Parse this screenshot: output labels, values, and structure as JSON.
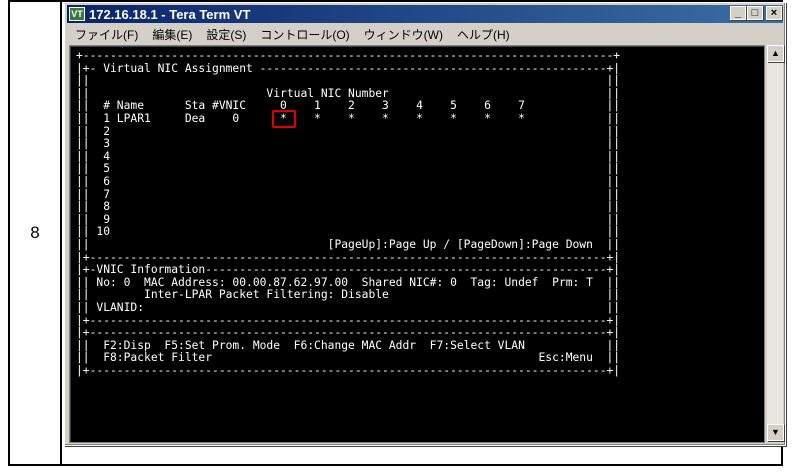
{
  "step": {
    "number": "8"
  },
  "window": {
    "title": "172.16.18.1 - Tera Term VT",
    "icon_name": "tera-term-icon",
    "controls": {
      "minimize": "_",
      "maximize": "□",
      "close": "×"
    }
  },
  "menu": [
    "ファイル(F)",
    "編集(E)",
    "設定(S)",
    "コントロール(O)",
    "ウィンドウ(W)",
    "ヘルプ(H)"
  ],
  "terminal": {
    "lines": [
      "+------------------------------------------------------------------------------+",
      "|+- Virtual NIC Assignment ---------------------------------------------------+|",
      "||                                                                            ||",
      "||                          Virtual NIC Number                                ||",
      "||  # Name      Sta #VNIC     0    1    2    3    4    5    6    7            ||",
      "||  1 LPAR1     Dea    0      *    *    *    *    *    *    *    *            ||",
      "||  2                                                                         ||",
      "||  3                                                                         ||",
      "||  4                                                                         ||",
      "||  5                                                                         ||",
      "||  6                                                                         ||",
      "||  7                                                                         ||",
      "||  8                                                                         ||",
      "||  9                                                                         ||",
      "|| 10                                                                         ||",
      "||                                   [PageUp]:Page Up / [PageDown]:Page Down  ||",
      "|+----------------------------------------------------------------------------+|",
      "|+-VNIC Information-----------------------------------------------------------+|",
      "|| No: 0  MAC Address: 00.00.87.62.97.00  Shared NIC#: 0  Tag: Undef  Prm: T  ||",
      "||        Inter-LPAR Packet Filtering: Disable                                ||",
      "|| VLANID:                                                                    ||",
      "|+----------------------------------------------------------------------------+|",
      "|+----------------------------------------------------------------------------+|",
      "||  F2:Disp  F5:Set Prom. Mode  F6:Change MAC Addr  F7:Select VLAN            ||",
      "||  F8:Packet Filter                                                Esc:Menu  ||",
      "|+----------------------------------------------------------------------------+|"
    ]
  },
  "highlight": {
    "color": "#e00000"
  },
  "scrollbar": {
    "up": "▲",
    "down": "▼"
  }
}
